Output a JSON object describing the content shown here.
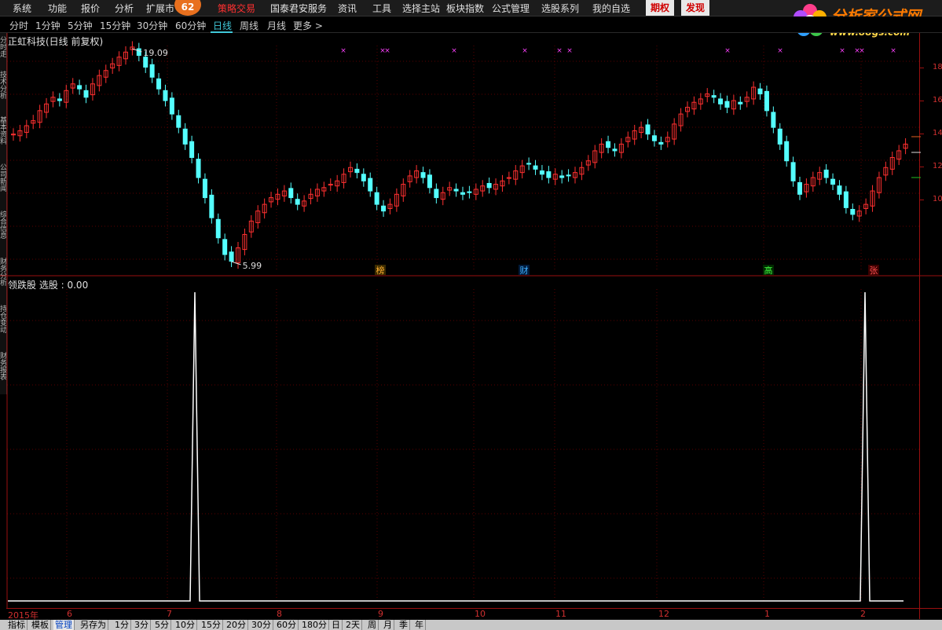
{
  "menu": {
    "items": [
      "系统",
      "功能",
      "报价",
      "分析",
      "扩展市",
      "策略交易",
      "国泰君安服务",
      "资讯",
      "工具",
      "选择主站",
      "板块指数",
      "公式管理",
      "选股系列",
      "我的自选"
    ],
    "badge": "62",
    "buttons": [
      "期权",
      "发现"
    ]
  },
  "logo": {
    "title": "分析家公式网",
    "url": "www.88gs.com"
  },
  "tabs": [
    "分时",
    "1分钟",
    "5分钟",
    "15分钟",
    "30分钟",
    "60分钟",
    "日线",
    "周线",
    "月线",
    "更多 >"
  ],
  "active_tab": "日线",
  "left_tabs": [
    "分时走势",
    "技术分析",
    "基本资料",
    "公司新闻",
    "综合信息",
    "财务分析",
    "持仓变动",
    "财务报表"
  ],
  "stock_title": "正虹科技(日线 前复权)",
  "indicator_title": "领跌股 选股 : 0.00",
  "price_high_label": "19.09",
  "price_low_label": "5.99",
  "event_markers": [
    "榜",
    "财",
    "高",
    "张"
  ],
  "date_labels": [
    "2015年",
    "6",
    "7",
    "8",
    "9",
    "10",
    "11",
    "12",
    "1",
    "2"
  ],
  "right_axis_labels": [
    "18",
    "16",
    "14",
    "12",
    "10"
  ],
  "bottom_buttons": [
    "指标",
    "模板",
    "管理",
    "另存为",
    "1分",
    "3分",
    "5分",
    "10分",
    "15分",
    "20分",
    "30分",
    "60分",
    "180分",
    "日",
    "2天",
    "周",
    "月",
    "季",
    "年"
  ],
  "bottom_active": "管理",
  "colors": {
    "up": "#ff3030",
    "down": "#54ffff",
    "signal": "#ffffff",
    "marker": "#ff40ff",
    "grid": "#5a0000"
  },
  "chart_data": {
    "type": "candlestick",
    "title": "正虹科技(日线 前复权)",
    "max_price": 19.09,
    "min_price": 5.99,
    "close_series": [
      13.8,
      14.0,
      14.3,
      14.6,
      15.2,
      15.6,
      16.0,
      15.8,
      16.4,
      16.8,
      16.5,
      16.0,
      16.8,
      17.3,
      17.6,
      18.0,
      18.4,
      18.7,
      19.0,
      18.5,
      17.8,
      17.2,
      16.5,
      15.8,
      15.0,
      14.2,
      13.2,
      12.4,
      11.2,
      10.0,
      8.8,
      7.6,
      6.6,
      6.2,
      7.0,
      7.8,
      8.6,
      9.2,
      9.6,
      10.0,
      10.2,
      10.4,
      10.0,
      9.6,
      9.8,
      10.2,
      10.5,
      10.6,
      10.8,
      11.0,
      11.4,
      11.8,
      11.5,
      11.0,
      10.4,
      9.6,
      9.2,
      9.6,
      10.2,
      10.8,
      11.3,
      11.6,
      11.2,
      10.6,
      10.0,
      10.3,
      10.6,
      10.4,
      10.2,
      10.3,
      10.5,
      10.7,
      10.6,
      10.8,
      11.0,
      11.2,
      11.6,
      11.9,
      12.0,
      11.7,
      11.4,
      11.2,
      11.4,
      11.2,
      11.3,
      11.5,
      11.8,
      12.2,
      12.8,
      13.2,
      13.0,
      12.8,
      13.2,
      13.6,
      14.0,
      14.2,
      13.8,
      13.4,
      13.2,
      13.6,
      14.4,
      15.0,
      15.4,
      15.7,
      15.9,
      16.2,
      16.0,
      15.6,
      15.4,
      15.8,
      15.6,
      16.0,
      16.6,
      16.2,
      15.2,
      14.2,
      13.2,
      12.2,
      11.0,
      10.2,
      10.8,
      11.2,
      11.5,
      11.2,
      10.8,
      10.2,
      9.4,
      9.0,
      9.2,
      9.6,
      10.4,
      11.2,
      11.8,
      12.4,
      12.8,
      13.2
    ]
  },
  "signal_data": {
    "type": "line",
    "signal_dates": [
      "7月上旬",
      "2月下旬"
    ]
  }
}
